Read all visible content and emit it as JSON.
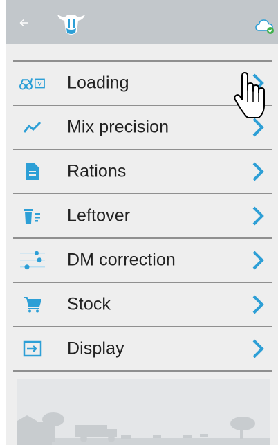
{
  "colors": {
    "topbar": "#c2c7cb",
    "background": "#eeeeee",
    "accent": "#2d9fd6",
    "divider": "#8f8f8f",
    "text": "#222222"
  },
  "header": {
    "back_icon": "arrow-left-icon",
    "logo": "cow-head-logo",
    "sync_icon": "cloud-sync-icon"
  },
  "menu": {
    "items": [
      {
        "label": "Loading",
        "icon": "loader-bucket-icon"
      },
      {
        "label": "Mix precision",
        "icon": "trend-line-icon"
      },
      {
        "label": "Rations",
        "icon": "document-icon"
      },
      {
        "label": "Leftover",
        "icon": "trash-list-icon"
      },
      {
        "label": "DM correction",
        "icon": "sliders-icon"
      },
      {
        "label": "Stock",
        "icon": "cart-icon"
      },
      {
        "label": "Display",
        "icon": "screen-enter-icon"
      }
    ]
  }
}
